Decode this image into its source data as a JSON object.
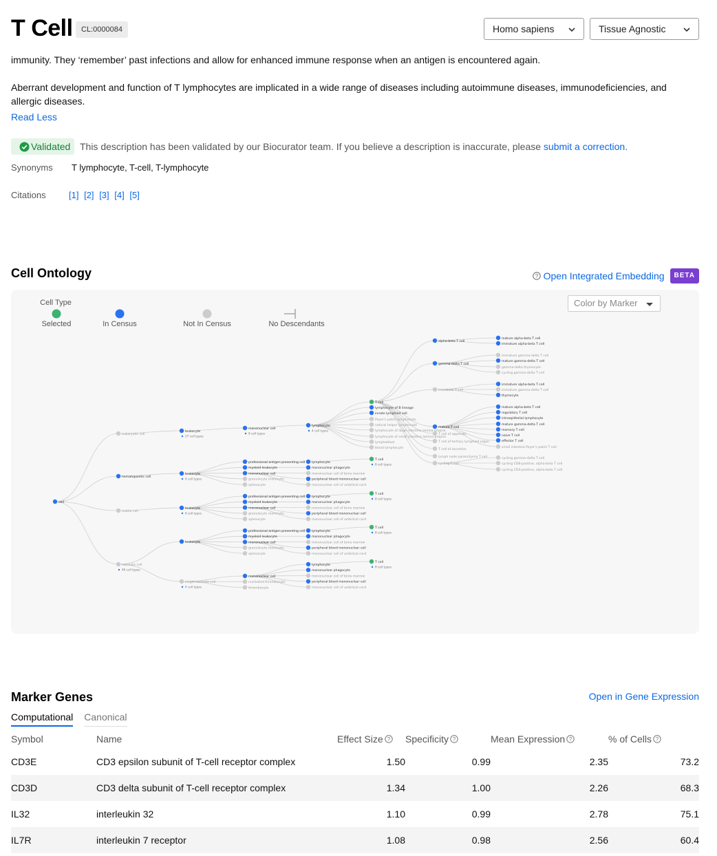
{
  "header": {
    "title": "T Cell",
    "cl_id": "CL:0000084",
    "species": "Homo sapiens",
    "tissue": "Tissue Agnostic"
  },
  "description": {
    "para1_tail": "immunity. They ‘remember’ past infections and allow for enhanced immune response when an antigen is encountered again.",
    "para2": "Aberrant development and function of T lymphocytes are implicated in a wide range of diseases including autoimmune diseases, immunodeficiencies, and allergic diseases.",
    "read_less": "Read Less",
    "validated_label": "Validated",
    "validated_text": "This description has been validated by our Biocurator team. If you believe a description is inaccurate, please",
    "correction_link": "submit a correction."
  },
  "meta": {
    "synonyms_label": "Synonyms",
    "synonyms_value": "T lymphocyte, T-cell, T-lymphocyte",
    "citations_label": "Citations",
    "citations": [
      "[1]",
      "[2]",
      "[3]",
      "[4]",
      "[5]"
    ]
  },
  "ontology": {
    "title": "Cell Ontology",
    "embedding_link": "Open Integrated Embedding",
    "beta": "BETA",
    "legend": {
      "cell_type": "Cell Type",
      "selected": "Selected",
      "in_census": "In Census",
      "not_in_census": "Not In Census",
      "no_descendants": "No Descendants"
    },
    "color_by": "Color by Marker",
    "colors": {
      "selected": "#3cb371",
      "in_census": "#2a72f0",
      "not_in_census": "#cccccc"
    },
    "nodes": {
      "cell": "cell",
      "eukaryotic": "eukaryotic cell",
      "hematopoietic": "hematopoietic cell",
      "motile": "motile cell",
      "nucleate": "nucleate cell",
      "nucleate_sub": "46 cell types",
      "leukocyte": "leukocyte",
      "leukocyte_sub": "27 cell types",
      "leukocyte_short_sub": "6 cell types",
      "mononuclear": "mononuclear cell",
      "mononuclear_sub": "8 cell types",
      "lymphocyte": "lymphocyte",
      "lymphocyte_sub": "4 cell types",
      "single_nucleate": "single nucleate cell",
      "single_nucleate_sub": "4 cell types",
      "t_cell": "T cell",
      "t_cell_sub": "8 cell types",
      "level2": [
        "professional antigen presenting cell",
        "myeloid leukocyte",
        "mononuclear cell",
        "granulocyte monocyte",
        "splenocyte"
      ],
      "level3": [
        "lymphocyte",
        "mononuclear phagocyte",
        "mononuclear cell of bone marrow",
        "peripheral blood mononuclear cell",
        "mononuclear cell of umbilical cord"
      ],
      "level3_single": [
        "mononuclear cell",
        "nucleated thrombocyte",
        "thrombocyte"
      ],
      "lymph_children": [
        "T cell",
        "lymphocyte of B lineage",
        "innate lymphoid cell",
        "Peyer's patch lymphocyte",
        "natural helper lymphocyte",
        "lymphocyte of large intestine lamina propria",
        "lymphocyte of small intestine lamina propria",
        "lymphoblast",
        "blood lymphocyte"
      ],
      "t_children": [
        "alpha-beta T cell",
        "gamma-delta T cell",
        "immature T cell",
        "mature T cell",
        "T cell of appendix",
        "T cell of tertiary lymphoid organ",
        "T cell of secretion",
        "lymph node parenchyma T cell",
        "cycling T cell"
      ],
      "ab_children": [
        "mature alpha-beta T cell",
        "immature alpha-beta T cell"
      ],
      "gd_children": [
        "immature gamma-delta T cell",
        "mature gamma-delta T cell",
        "gamma-delta thymocyte",
        "cycling gamma-delta T cell"
      ],
      "imm_children": [
        "immature alpha-beta T cell",
        "immature gamma-delta T cell",
        "thymocyte"
      ],
      "mature_children": [
        "mature alpha-beta T cell",
        "regulatory T cell",
        "intraepithelial lymphocyte",
        "mature gamma-delta T cell",
        "memory T cell",
        "naive T cell",
        "effector T cell",
        "small intestine Peyer's patch T cell"
      ],
      "cycling_children": [
        "cycling gamma-delta T cell",
        "cycling CD8-positive, alpha-beta T cell",
        "cycling CD4-positive, alpha-beta T cell"
      ]
    }
  },
  "marker_genes": {
    "title": "Marker Genes",
    "gene_expression_link": "Open in Gene Expression",
    "tabs": [
      "Computational",
      "Canonical"
    ],
    "columns": [
      "Symbol",
      "Name",
      "Effect Size",
      "Specificity",
      "Mean Expression",
      "% of Cells"
    ],
    "rows": [
      {
        "symbol": "CD3E",
        "name": "CD3 epsilon subunit of T-cell receptor complex",
        "effect": "1.50",
        "spec": "0.99",
        "mean": "2.35",
        "pct": "73.2"
      },
      {
        "symbol": "CD3D",
        "name": "CD3 delta subunit of T-cell receptor complex",
        "effect": "1.34",
        "spec": "1.00",
        "mean": "2.26",
        "pct": "68.3"
      },
      {
        "symbol": "IL32",
        "name": "interleukin 32",
        "effect": "1.10",
        "spec": "0.99",
        "mean": "2.78",
        "pct": "75.1"
      },
      {
        "symbol": "IL7R",
        "name": "interleukin 7 receptor",
        "effect": "1.08",
        "spec": "0.98",
        "mean": "2.56",
        "pct": "60.4"
      }
    ]
  }
}
